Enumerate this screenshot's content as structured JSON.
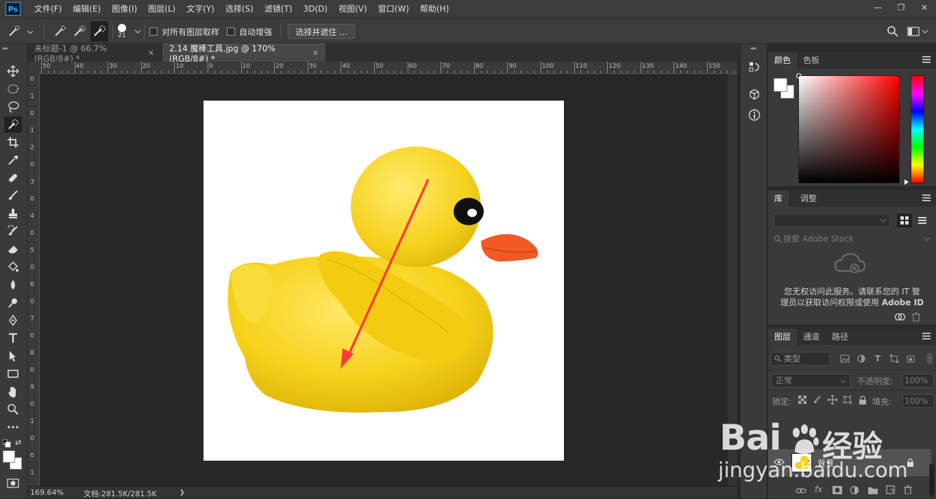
{
  "app": {
    "logo_text": "Ps"
  },
  "menu": [
    "文件(F)",
    "编辑(E)",
    "图像(I)",
    "图层(L)",
    "文字(Y)",
    "选择(S)",
    "滤镜(T)",
    "3D(D)",
    "视图(V)",
    "窗口(W)",
    "帮助(H)"
  ],
  "window_controls": {
    "minimize": "—",
    "restore": "❐",
    "close": "✕"
  },
  "options": {
    "brush_size": "21",
    "sample_all_layers": "对所有图层取样",
    "auto_enhance": "自动增强",
    "select_and_mask": "选择并遮住 ..."
  },
  "tabs": [
    {
      "label": "未标题-1 @ 66.7%(RGB/8#) *",
      "close": "✕"
    },
    {
      "label": "2.14 魔棒工具.jpg @ 170%(RGB/8#) *",
      "close": "✕"
    }
  ],
  "ruler": {
    "h_labels": [
      "50",
      "40",
      "30",
      "20",
      "10",
      "0",
      "10",
      "20",
      "30",
      "40",
      "50",
      "60",
      "70",
      "80",
      "90",
      "100",
      "110",
      "120",
      "130",
      "140",
      "150"
    ],
    "v_labels": [
      "0",
      "1",
      "0",
      "1",
      "2",
      "0",
      "3",
      "0",
      "4",
      "0",
      "5",
      "0",
      "6",
      "0",
      "7",
      "0",
      "8",
      "0",
      "9",
      "0",
      "1",
      "0",
      "0",
      "1"
    ]
  },
  "status": {
    "zoom": "169.64%",
    "doc_info": "文档:281.5K/281.5K",
    "arrow": "❯"
  },
  "color_panel": {
    "tabs": [
      "颜色",
      "色板"
    ],
    "base_hue": "#ff0000"
  },
  "library_panel": {
    "tabs": [
      "库",
      "调整"
    ],
    "search_placeholder": "搜索 Adobe Stock",
    "message_line1": "您无权访问此服务。请联系您的 IT 管",
    "message_line2": "理员以获取访问权限或使用",
    "message_bold": "Adobe ID"
  },
  "layers_panel": {
    "tabs": [
      "图层",
      "通道",
      "路径"
    ],
    "filter_kind": "类型",
    "blend_mode": "正常",
    "opacity_label": "不透明度:",
    "opacity_value": "100%",
    "lock_label": "锁定:",
    "fill_label": "填充:",
    "fill_value": "100%",
    "layers": [
      {
        "name": "背景"
      }
    ],
    "footer_fx": "fx"
  },
  "watermark": {
    "brand": "Bai",
    "brand_cn": "经验",
    "url": "jingyan.baidu.com"
  }
}
